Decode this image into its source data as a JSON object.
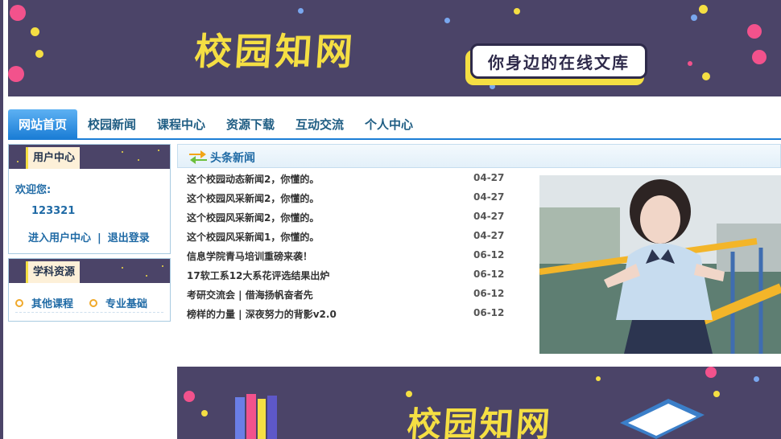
{
  "header": {
    "brand": "校园知网",
    "tagline": "你身边的在线文库"
  },
  "nav": {
    "items": [
      "网站首页",
      "校园新闻",
      "课程中心",
      "资源下载",
      "互动交流",
      "个人中心"
    ]
  },
  "user_center": {
    "title": "用户中心",
    "welcome": "欢迎您:",
    "username": "123321",
    "enter_link": "进入用户中心",
    "separator": "|",
    "logout_link": "退出登录"
  },
  "resources": {
    "title": "学科资源",
    "items": [
      "其他课程",
      "专业基础"
    ]
  },
  "news": {
    "title": "头条新闻",
    "items": [
      {
        "title": "这个校园动态新闻2，你懂的。",
        "date": "04-27"
      },
      {
        "title": "这个校园风采新闻2，你懂的。",
        "date": "04-27"
      },
      {
        "title": "这个校园风采新闻2，你懂的。",
        "date": "04-27"
      },
      {
        "title": "这个校园风采新闻1，你懂的。",
        "date": "04-27"
      },
      {
        "title": "信息学院青马培训重磅来袭！",
        "date": "06-12"
      },
      {
        "title": "17软工系12大系花评选结果出炉",
        "date": "06-12"
      },
      {
        "title": "考研交流会 | 借海扬帆奋者先",
        "date": "06-12"
      },
      {
        "title": "榜样的力量 | 深夜努力的背影v2.0",
        "date": "06-12"
      }
    ]
  },
  "footer_banner": {
    "brand": "校园知网"
  },
  "colors": {
    "banner_bg": "#4b4468",
    "brand_yellow": "#f5df43",
    "nav_active": "#1c7ed6",
    "link_blue": "#1f6aa5"
  }
}
